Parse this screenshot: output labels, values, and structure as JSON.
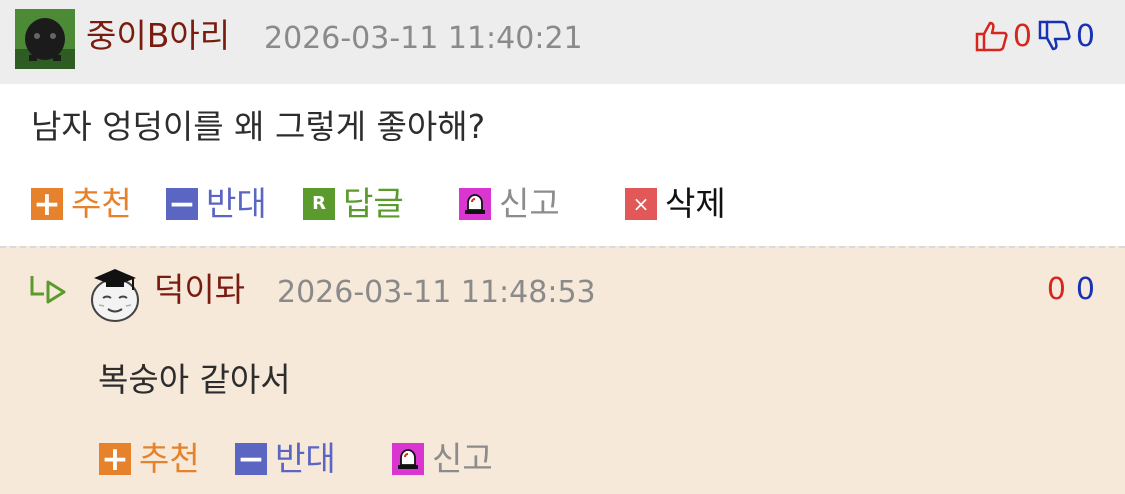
{
  "main_comment": {
    "username": "중이B아리",
    "timestamp": "2026-03-11 11:40:21",
    "upvotes": "0",
    "downvotes": "0",
    "body": "남자 엉덩이를 왜 그렇게 좋아해?",
    "actions": {
      "recommend": "추천",
      "oppose": "반대",
      "reply": "답글",
      "report": "신고",
      "delete": "삭제"
    },
    "icons": {
      "recommend": "+",
      "oppose": "−",
      "reply": "R",
      "delete": "×"
    }
  },
  "reply_comment": {
    "username": "덕이돠",
    "timestamp": "2026-03-11 11:48:53",
    "upvotes": "0",
    "downvotes": "0",
    "body": "복숭아 같아서",
    "actions": {
      "recommend": "추천",
      "oppose": "반대",
      "report": "신고"
    },
    "icons": {
      "recommend": "+",
      "oppose": "−"
    }
  },
  "colors": {
    "username": "#7a1b10",
    "recommend": "#e5822b",
    "oppose": "#5a66c2",
    "reply": "#5b9b2e",
    "report_icon": "#d935d0",
    "delete_icon": "#e25757",
    "upvote": "#d7261e",
    "downvote": "#1832b5",
    "reply_background": "#f7e9da"
  }
}
